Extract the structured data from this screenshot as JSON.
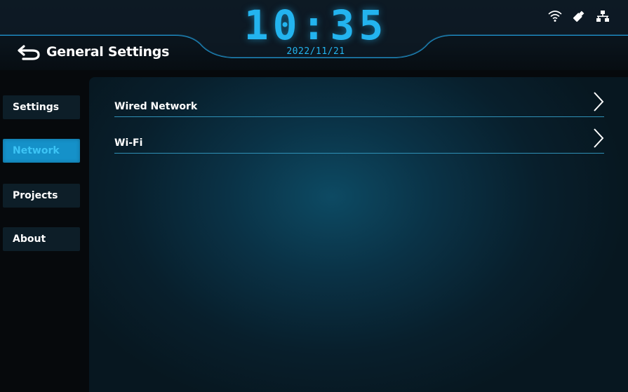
{
  "header": {
    "title": "General Settings",
    "time": "10:35",
    "date": "2022/11/21"
  },
  "status_icons": [
    "wifi-icon",
    "usb-drive-icon",
    "network-icon"
  ],
  "sidebar": {
    "items": [
      {
        "label": "Settings",
        "active": false
      },
      {
        "label": "Network",
        "active": true
      },
      {
        "label": "Projects",
        "active": false
      },
      {
        "label": "About",
        "active": false
      }
    ]
  },
  "main": {
    "rows": [
      {
        "label": "Wired Network"
      },
      {
        "label": "Wi-Fi"
      }
    ]
  },
  "colors": {
    "accent": "#23b4ef",
    "active_nav": "#1591c9",
    "nav_bg": "#0d1e28",
    "divider": "#2f90b6",
    "background": "#06090c"
  }
}
